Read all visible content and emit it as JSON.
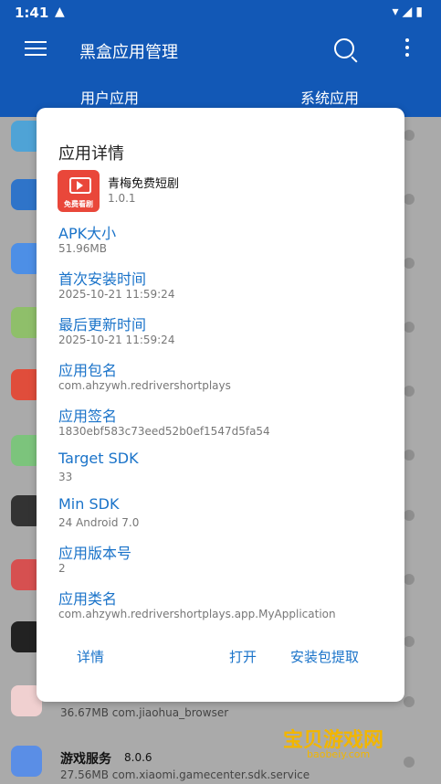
{
  "status": {
    "time": "1:41"
  },
  "app": {
    "title": "黑盒应用管理"
  },
  "tabs": [
    "用户应用",
    "系统应用"
  ],
  "dialog": {
    "title": "应用详情",
    "app_name": "青梅免费短剧",
    "app_version": "1.0.1",
    "icon_label": "免费看剧",
    "fields": [
      {
        "label": "APK大小",
        "value": "51.96MB"
      },
      {
        "label": "首次安装时间",
        "value": "2025-10-21 11:59:24"
      },
      {
        "label": "最后更新时间",
        "value": "2025-10-21 11:59:24"
      },
      {
        "label": "应用包名",
        "value": "com.ahzywh.redrivershortplays"
      },
      {
        "label": "应用签名",
        "value": "1830ebf583c73eed52b0ef1547d5fa54"
      },
      {
        "label": "Target SDK",
        "value": "33"
      },
      {
        "label": "Min SDK",
        "value": "24 Android 7.0"
      },
      {
        "label": "应用版本号",
        "value": "2"
      },
      {
        "label": "应用类名",
        "value": "com.ahzywh.redrivershortplays.app.MyApplication"
      }
    ],
    "buttons": {
      "details": "详情",
      "open": "打开",
      "extract": "安装包提取"
    }
  },
  "background_list": {
    "row1": {
      "sub": "36.67MB com.jiaohua_browser"
    },
    "row2": {
      "name": "游戏服务",
      "version": "8.0.6",
      "sub": "27.56MB com.xiaomi.gamecenter.sdk.service"
    }
  },
  "watermark": {
    "line1": "宝贝游戏网",
    "line2": "baobeiy.com"
  }
}
